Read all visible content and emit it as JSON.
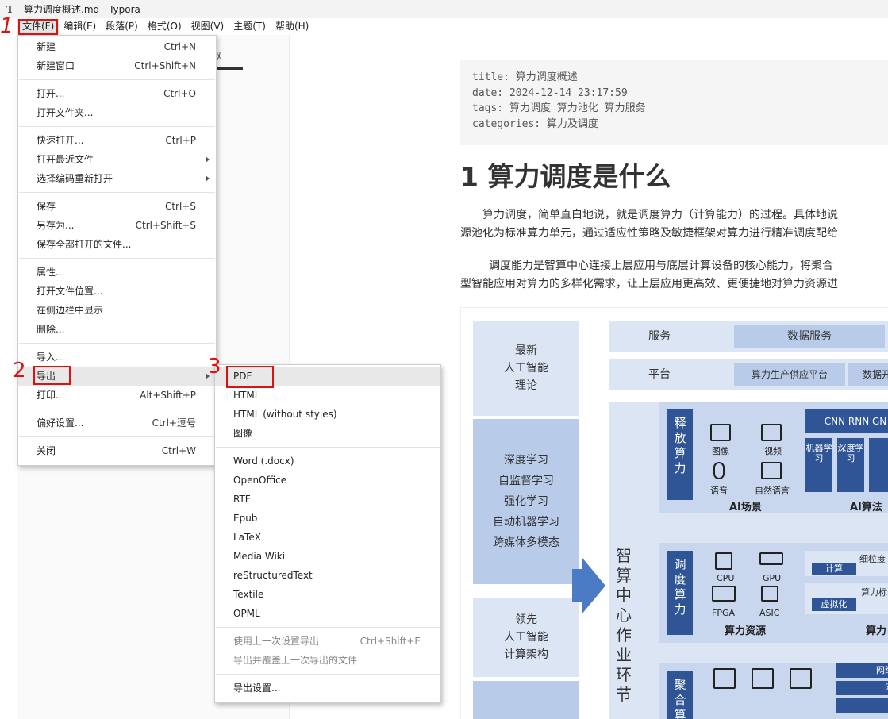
{
  "window": {
    "title": "算力调度概述.md - Typora",
    "app_icon": "T"
  },
  "menubar": [
    "文件(F)",
    "编辑(E)",
    "段落(P)",
    "格式(O)",
    "视图(V)",
    "主题(T)",
    "帮助(H)"
  ],
  "sidebar": {
    "tab_label": "纲"
  },
  "file_menu": {
    "groups": [
      [
        {
          "label": "新建",
          "shortcut": "Ctrl+N"
        },
        {
          "label": "新建窗口",
          "shortcut": "Ctrl+Shift+N"
        }
      ],
      [
        {
          "label": "打开...",
          "shortcut": "Ctrl+O"
        },
        {
          "label": "打开文件夹...",
          "shortcut": ""
        }
      ],
      [
        {
          "label": "快速打开...",
          "shortcut": "Ctrl+P"
        },
        {
          "label": "打开最近文件",
          "shortcut": ""
        },
        {
          "label": "选择编码重新打开",
          "shortcut": ""
        }
      ],
      [
        {
          "label": "保存",
          "shortcut": "Ctrl+S"
        },
        {
          "label": "另存为...",
          "shortcut": "Ctrl+Shift+S"
        },
        {
          "label": "保存全部打开的文件...",
          "shortcut": ""
        }
      ],
      [
        {
          "label": "属性...",
          "shortcut": ""
        },
        {
          "label": "打开文件位置...",
          "shortcut": ""
        },
        {
          "label": "在侧边栏中显示",
          "shortcut": ""
        },
        {
          "label": "删除...",
          "shortcut": ""
        }
      ],
      [
        {
          "label": "导入...",
          "shortcut": ""
        },
        {
          "label": "导出",
          "shortcut": ""
        },
        {
          "label": "打印...",
          "shortcut": "Alt+Shift+P"
        }
      ],
      [
        {
          "label": "偏好设置...",
          "shortcut": "Ctrl+逗号"
        }
      ],
      [
        {
          "label": "关闭",
          "shortcut": "Ctrl+W"
        }
      ]
    ]
  },
  "export_menu": {
    "groups": [
      [
        {
          "label": "PDF"
        },
        {
          "label": "HTML"
        },
        {
          "label": "HTML (without styles)"
        },
        {
          "label": "图像"
        }
      ],
      [
        {
          "label": "Word (.docx)"
        },
        {
          "label": "OpenOffice"
        },
        {
          "label": "RTF"
        },
        {
          "label": "Epub"
        },
        {
          "label": "LaTeX"
        },
        {
          "label": "Media Wiki"
        },
        {
          "label": "reStructuredText"
        },
        {
          "label": "Textile"
        },
        {
          "label": "OPML"
        }
      ],
      [
        {
          "label": "使用上一次设置导出",
          "shortcut": "Ctrl+Shift+E"
        },
        {
          "label": "导出并覆盖上一次导出的文件",
          "shortcut": ""
        }
      ],
      [
        {
          "label": "导出设置..."
        }
      ]
    ]
  },
  "annotations": [
    "1",
    "2",
    "3"
  ],
  "document": {
    "frontmatter": [
      "title: 算力调度概述",
      "date: 2024-12-14 23:17:59",
      "tags: 算力调度 算力池化 算力服务",
      "categories: 算力及调度"
    ],
    "heading": "1 算力调度是什么",
    "para1_line1": "算力调度，简单直白地说，就是调度算力（计算能力）的过程。具体地说",
    "para1_line2": "源池化为标准算力单元，通过适应性策略及敏捷框架对算力进行精准调度配给",
    "para2_line1": "调度能力是智算中心连接上层应用与底层计算设备的核心能力，将聚合",
    "para2_line2": "型智能应用对算力的多样化需求，让上层应用更高效、更便捷地对算力资源进"
  },
  "diagram": {
    "left_top": "最新\n人工智能\n理论",
    "left_mid": [
      "深度学习",
      "自监督学习",
      "强化学习",
      "自动机器学习",
      "跨媒体多模态"
    ],
    "left_low": "领先\n人工智能\n计算架构",
    "vertical": "智算中心作业环节",
    "row1_label": "服务",
    "row1_pill": "数据服务",
    "row2_label": "平台",
    "row2_pill1": "算力生产供应平台",
    "row2_pill2": "数据开",
    "panel1_side": "释放算力",
    "panel1_icons": [
      "图像",
      "视频",
      "语音",
      "自然语言"
    ],
    "panel1_caption": "AI场景",
    "panel1_caption2": "AI算法",
    "panel1_algos": "CNN  RNN  GN",
    "panel1_cols": [
      "机器学习",
      "深度学习"
    ],
    "panel2_side": "调度算力",
    "panel2_icons": [
      "CPU",
      "GPU",
      "FPGA",
      "ASIC"
    ],
    "panel2_caption": "算力资源",
    "panel2_caption2": "算力",
    "panel2_tags": [
      "细粒度",
      "计算",
      "算力标",
      "虚拟化"
    ],
    "panel3_side": "聚合算",
    "panel3_tags": [
      "网络自",
      "网络",
      "RD"
    ]
  }
}
